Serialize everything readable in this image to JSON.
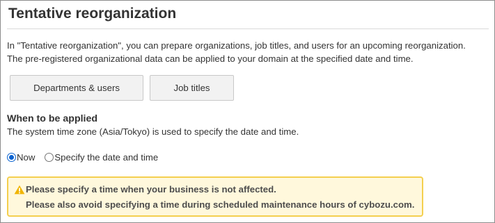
{
  "page": {
    "title": "Tentative reorganization",
    "description_lines": [
      "In \"Tentative reorganization\", you can prepare organizations, job titles, and users for an upcoming reorganization.",
      "The pre-registered organizational data can be applied to your domain at the specified date and time."
    ]
  },
  "buttons": {
    "departments_users": "Departments & users",
    "job_titles": "Job titles"
  },
  "apply_section": {
    "heading": "When to be applied",
    "description": "The system time zone (Asia/Tokyo) is used to specify the date and time.",
    "options": [
      {
        "label": "Now",
        "selected": true
      },
      {
        "label": "Specify the date and time",
        "selected": false
      }
    ]
  },
  "warning": {
    "icon": "warning-triangle-icon",
    "lines": [
      "Please specify a time when your business is not affected.",
      "Please also avoid specifying a time during scheduled maintenance hours of cybozu.com."
    ]
  },
  "colors": {
    "warning_background": "#fff8dc",
    "warning_border": "#f4cf4f",
    "warning_icon": "#f0b400",
    "radio_selected": "#0b63d0",
    "button_background": "#f2f2f2"
  }
}
